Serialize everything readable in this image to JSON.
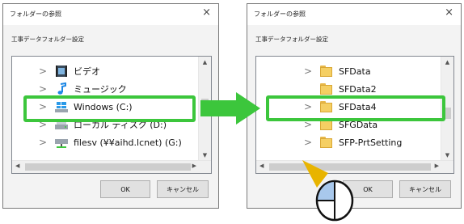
{
  "left_dialog": {
    "title": "フォルダーの参照",
    "close": "×",
    "description": "工事データフォルダー設定",
    "tree_items": [
      {
        "label": "ビデオ",
        "icon": "video-icon"
      },
      {
        "label": "ミュージック",
        "icon": "music-icon"
      },
      {
        "label": "Windows (C:)",
        "icon": "windows-drive-icon"
      },
      {
        "label": "ローカル ディスク (D:)",
        "icon": "local-disk-icon"
      },
      {
        "label": "filesv (¥¥aihd.lcnet) (G:)",
        "icon": "network-drive-icon"
      }
    ],
    "ok_label": "OK",
    "cancel_label": "キャンセル"
  },
  "right_dialog": {
    "title": "フォルダーの参照",
    "close": "×",
    "description": "工事データフォルダー設定",
    "tree_items": [
      {
        "label": "SFData",
        "icon": "folder-icon"
      },
      {
        "label": "SFData2",
        "icon": "folder-icon"
      },
      {
        "label": "SFData4",
        "icon": "folder-icon"
      },
      {
        "label": "SFGData",
        "icon": "folder-icon"
      },
      {
        "label": "SFP-PrtSetting",
        "icon": "folder-icon"
      }
    ],
    "ok_label": "OK",
    "cancel_label": "キャンセル"
  },
  "colors": {
    "highlight": "#3cc63c",
    "pointer": "#e8b400",
    "mouse_button": "#a8c8ec"
  },
  "tree_chevron": "›"
}
